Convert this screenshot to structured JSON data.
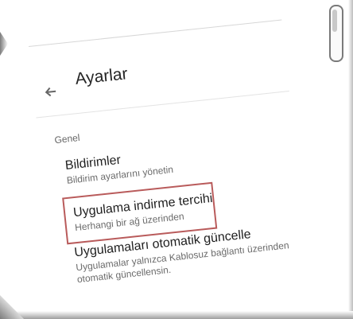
{
  "app": {
    "title": "Ayarlar",
    "section": "Genel"
  },
  "settings": {
    "items": [
      {
        "title": "Bildirimler",
        "subtitle": "Bildirim ayarlarını yönetin"
      },
      {
        "title": "Uygulama indirme tercihi",
        "subtitle": "Herhangi bir ağ üzerinden"
      },
      {
        "title": "Uygulamaları otomatik güncelle",
        "subtitle": "Uygulamalar yalnızca Kablosuz bağlantı üzerinden otomatik güncellensin."
      }
    ]
  },
  "icons": {
    "back": "back-arrow-icon"
  },
  "colors": {
    "highlight_border": "#b95b5b",
    "text_primary": "#202020",
    "text_secondary": "#6b6b6b"
  }
}
